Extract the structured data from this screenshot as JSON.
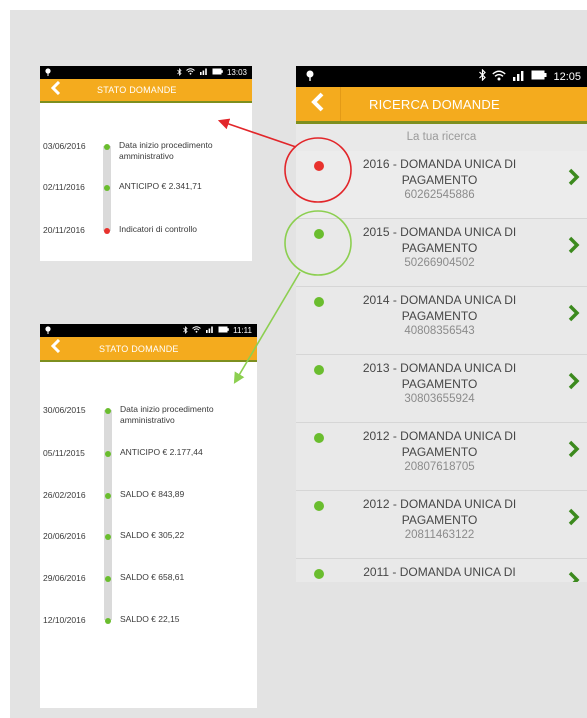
{
  "phone_small_top": {
    "status_time": "13:03",
    "title": "STATO DOMANDE",
    "events": [
      {
        "date": "03/06/2016",
        "text": "Data inizio procedimento amministrativo",
        "status": "green"
      },
      {
        "date": "02/11/2016",
        "text": "ANTICIPO € 2.341,71",
        "status": "green"
      },
      {
        "date": "20/11/2016",
        "text": "Indicatori di controllo",
        "status": "red"
      }
    ]
  },
  "phone_small_bottom": {
    "status_time": "11:11",
    "title": "STATO DOMANDE",
    "events": [
      {
        "date": "30/06/2015",
        "text": "Data inizio procedimento amministrativo",
        "status": "green"
      },
      {
        "date": "05/11/2015",
        "text": "ANTICIPO € 2.177,44",
        "status": "green"
      },
      {
        "date": "26/02/2016",
        "text": "SALDO € 843,89",
        "status": "green"
      },
      {
        "date": "20/06/2016",
        "text": "SALDO € 305,22",
        "status": "green"
      },
      {
        "date": "29/06/2016",
        "text": "SALDO € 658,61",
        "status": "green"
      },
      {
        "date": "12/10/2016",
        "text": "SALDO € 22,15",
        "status": "green"
      }
    ]
  },
  "phone_main": {
    "status_time": "12:05",
    "title": "RICERCA DOMANDE",
    "subtitle": "La tua ricerca",
    "items": [
      {
        "title": "2016 - DOMANDA UNICA DI PAGAMENTO",
        "number": "60262545886",
        "status": "red"
      },
      {
        "title": "2015 - DOMANDA UNICA DI PAGAMENTO",
        "number": "50266904502",
        "status": "green"
      },
      {
        "title": "2014 - DOMANDA UNICA DI PAGAMENTO",
        "number": "40808356543",
        "status": "green"
      },
      {
        "title": "2013 - DOMANDA UNICA DI PAGAMENTO",
        "number": "30803655924",
        "status": "green"
      },
      {
        "title": "2012 - DOMANDA UNICA DI PAGAMENTO",
        "number": "20807618705",
        "status": "green"
      },
      {
        "title": "2012 - DOMANDA UNICA DI PAGAMENTO",
        "number": "20811463122",
        "status": "green"
      },
      {
        "title": "2011 - DOMANDA UNICA DI",
        "number": "",
        "status": "green"
      }
    ]
  },
  "colors": {
    "accent": "#f4ab1e",
    "appbar_border": "#7d8f1f",
    "status_green": "#6abd2e",
    "status_red": "#e8322d",
    "chevron": "#3c8a1e",
    "annotation_red": "#e2262a",
    "annotation_green": "#8ccf50"
  },
  "icons": {
    "back": "chevron-left-icon",
    "list_chevron": "chevron-right-icon",
    "status": [
      "location-pin-icon",
      "bluetooth-icon",
      "wifi-icon",
      "signal-icon",
      "battery-icon"
    ]
  }
}
